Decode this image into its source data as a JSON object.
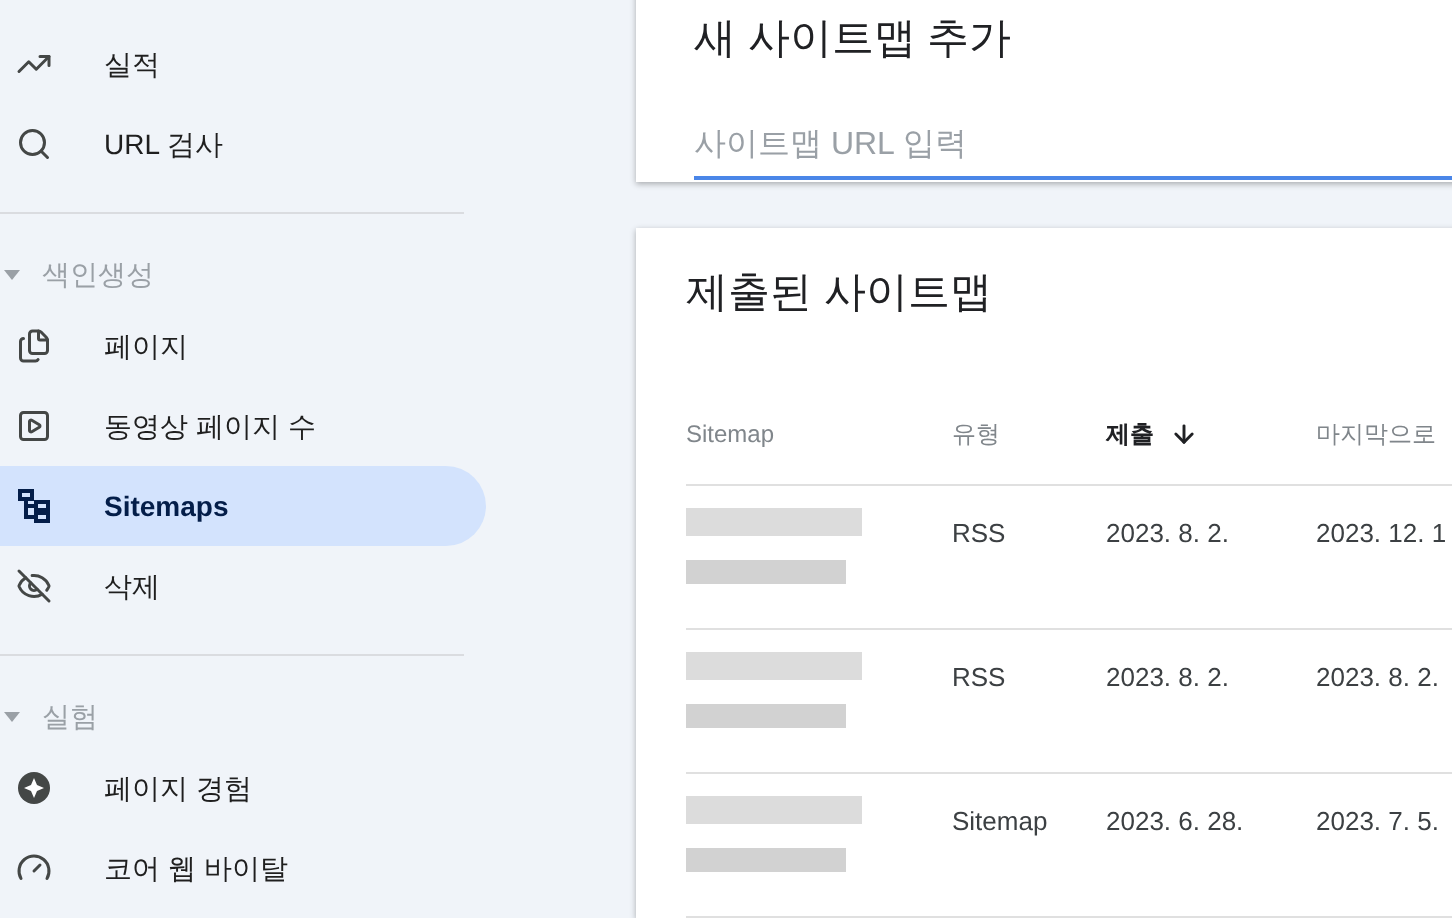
{
  "sidebar": {
    "items": [
      {
        "kind": "item",
        "label": "실적",
        "selected": false
      },
      {
        "kind": "item",
        "label": "URL 검사",
        "selected": false
      },
      {
        "kind": "divider"
      },
      {
        "kind": "section",
        "label": "색인생성",
        "expanded": true
      },
      {
        "kind": "item",
        "label": "페이지",
        "selected": false
      },
      {
        "kind": "item",
        "label": "동영상 페이지 수",
        "selected": false
      },
      {
        "kind": "item",
        "label": "Sitemaps",
        "selected": true
      },
      {
        "kind": "item",
        "label": "삭제",
        "selected": false
      },
      {
        "kind": "divider"
      },
      {
        "kind": "section",
        "label": "실험",
        "expanded": true
      },
      {
        "kind": "item",
        "label": "페이지 경험",
        "selected": false
      },
      {
        "kind": "item",
        "label": "코어 웹 바이탈",
        "selected": false
      }
    ]
  },
  "add_card": {
    "title": "새 사이트맵 추가",
    "placeholder": "사이트맵 URL 입력"
  },
  "submitted_card": {
    "title": "제출된 사이트맵",
    "columns": [
      {
        "label": "Sitemap",
        "sorted": false
      },
      {
        "label": "유형",
        "sorted": false
      },
      {
        "label": "제출",
        "sorted": true
      },
      {
        "label": "마지막으로",
        "sorted": false
      }
    ],
    "rows": [
      {
        "type": "RSS",
        "submitted": "2023. 8. 2.",
        "last": "2023. 12. 1"
      },
      {
        "type": "RSS",
        "submitted": "2023. 8. 2.",
        "last": "2023. 8. 2."
      },
      {
        "type": "Sitemap",
        "submitted": "2023. 6. 28.",
        "last": "2023. 7. 5."
      }
    ]
  }
}
